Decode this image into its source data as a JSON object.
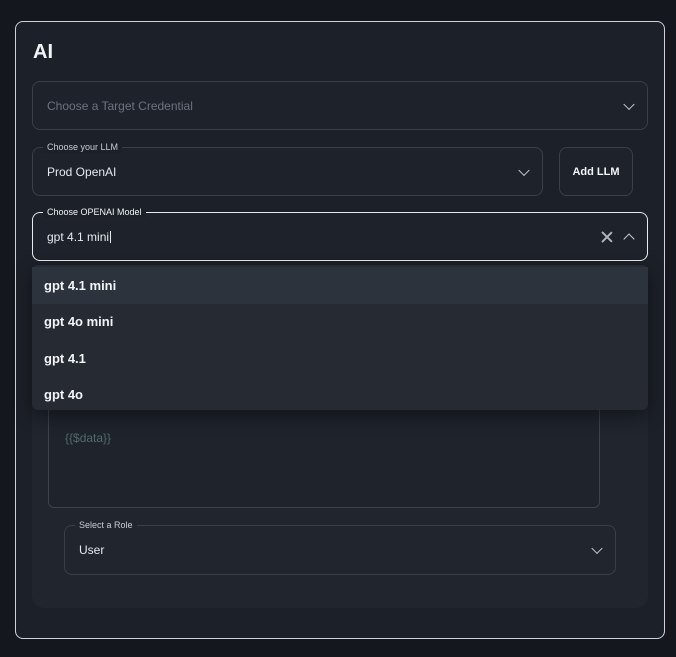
{
  "panel": {
    "title": "AI"
  },
  "target_credential": {
    "placeholder": "Choose a Target Credential"
  },
  "llm": {
    "label": "Choose your LLM",
    "value": "Prod OpenAI",
    "add_button": "Add LLM"
  },
  "model": {
    "label": "Choose OPENAI Model",
    "value": "gpt 4.1 mini",
    "options": [
      "gpt 4.1 mini",
      "gpt 4o mini",
      "gpt 4.1",
      "gpt 4o"
    ]
  },
  "message": {
    "placeholder": "{{$data}}"
  },
  "role": {
    "label": "Select a Role",
    "value": "User"
  }
}
